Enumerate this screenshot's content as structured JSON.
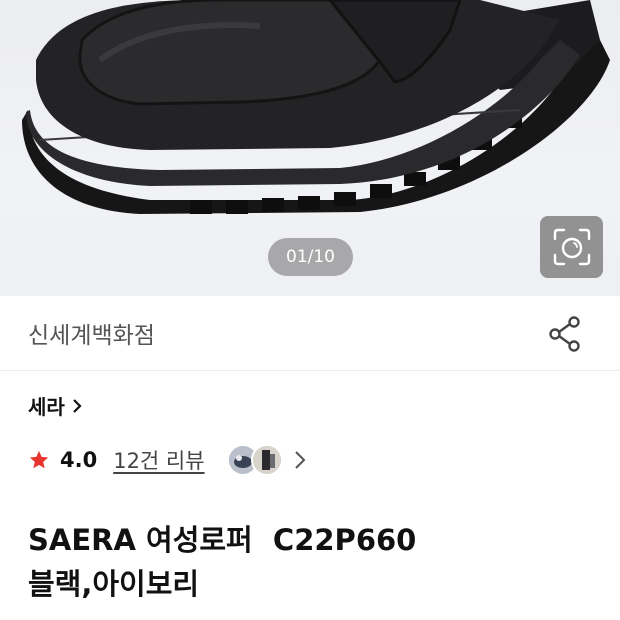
{
  "gallery": {
    "counter": "01/10",
    "image_alt": "black chunky loafer shoe"
  },
  "store": {
    "name": "신세계백화점",
    "share_icon": "share-icon"
  },
  "brand": {
    "name": "세라",
    "chevron": "›"
  },
  "rating": {
    "value": "4.0",
    "reviews": "12건 리뷰",
    "chevron": "›",
    "star_color": "#e8342f"
  },
  "product": {
    "title_line1": "SAERA 여성로퍼  C22P660",
    "title_line2": "블랙,아이보리"
  }
}
